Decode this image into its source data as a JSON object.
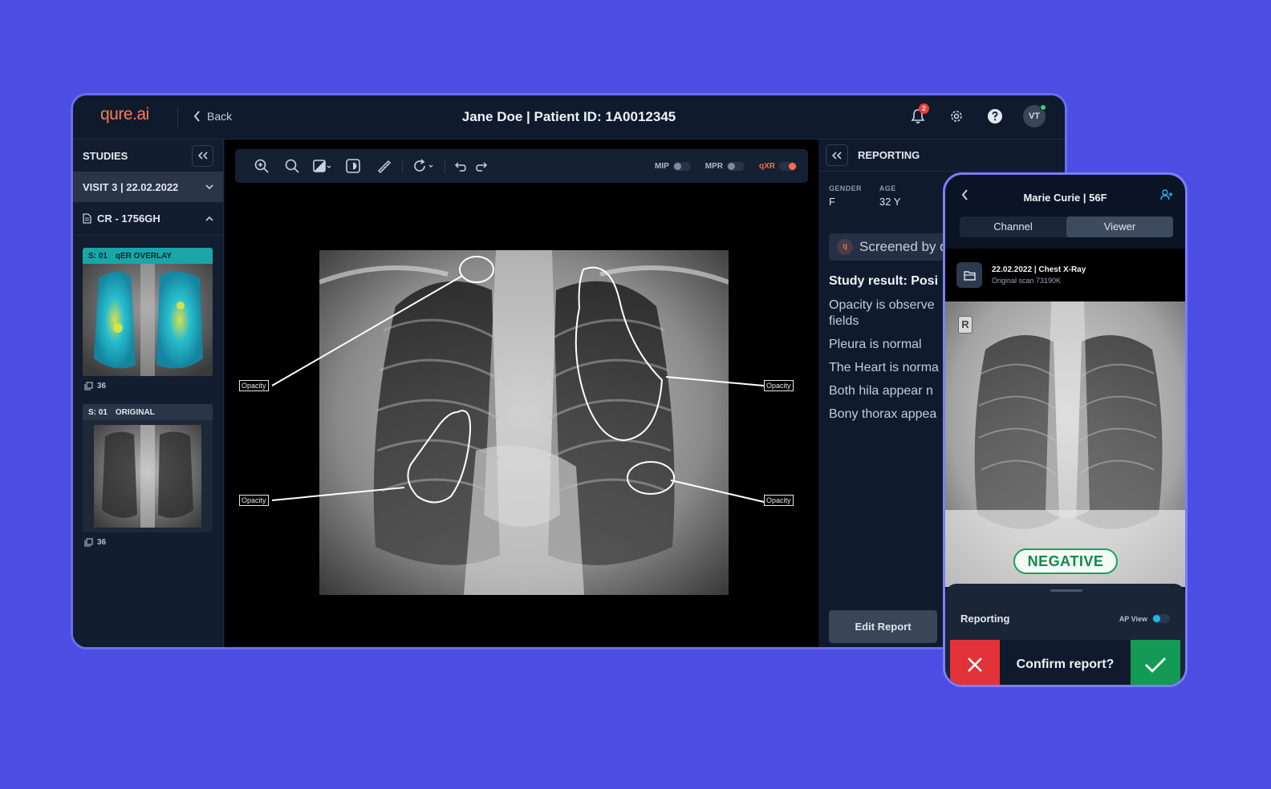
{
  "app": {
    "logo": "qure.ai",
    "back_label": "Back",
    "title": "Jane Doe | Patient ID: 1A0012345",
    "notification_count": "2",
    "avatar_initials": "VT"
  },
  "sidebar": {
    "title": "STUDIES",
    "visit": "VISIT 3 | 22.02.2022",
    "series": "CR - 1756GH",
    "thumbs": [
      {
        "series_no": "S: 01",
        "label": "qER OVERLAY",
        "count": "36"
      },
      {
        "series_no": "S: 01",
        "label": "ORIGINAL",
        "count": "36"
      }
    ]
  },
  "toolbar": {
    "mip_label": "MIP",
    "mpr_label": "MPR",
    "qxr_label": "qXR",
    "mip_on": false,
    "mpr_on": false,
    "qxr_on": true
  },
  "annotations": {
    "label": "Opacity"
  },
  "report": {
    "title": "REPORTING",
    "gender_label": "GENDER",
    "gender_value": "F",
    "age_label": "AGE",
    "age_value": "32 Y",
    "screened_text": "Screened by q",
    "study_result": "Study result: Posi",
    "findings": [
      "Opacity is observe",
      "fields",
      "Pleura is normal",
      "The Heart is norma",
      "Both hila appear n",
      "Bony thorax appea"
    ],
    "edit_button": "Edit Report"
  },
  "mobile": {
    "title": "Marie Curie | 56F",
    "tabs": [
      "Channel",
      "Viewer"
    ],
    "active_tab": "Viewer",
    "study_title": "22.02.2022 | Chest X-Ray",
    "study_sub": "Original scan 73190K",
    "marker": "R",
    "result_badge": "NEGATIVE",
    "sheet_title": "Reporting",
    "ap_view_label": "AP View",
    "ap_view_on": true,
    "confirm_text": "Confirm report?"
  },
  "colors": {
    "background": "#4b4de3",
    "brand": "#ff7a56",
    "negative": "#16a35c",
    "reject": "#e2333a",
    "confirm": "#139a55"
  }
}
